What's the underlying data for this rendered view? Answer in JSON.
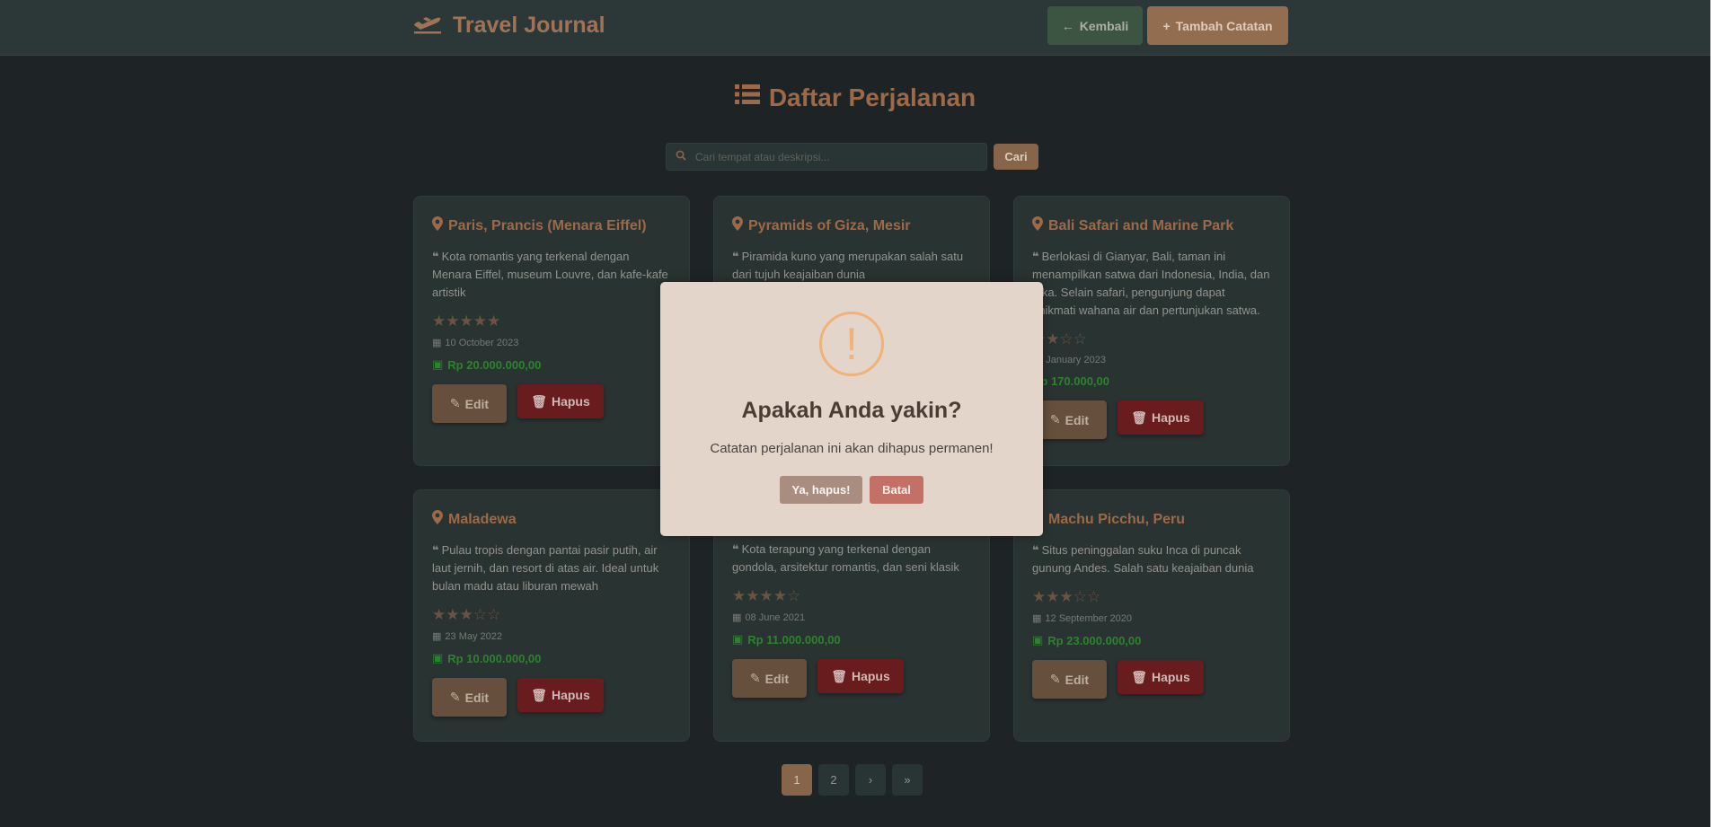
{
  "navbar": {
    "brand": "Travel Journal",
    "back_label": "Kembali",
    "add_label": "Tambah Catatan"
  },
  "page": {
    "title": "Daftar Perjalanan"
  },
  "search": {
    "placeholder": "Cari tempat atau deskripsi...",
    "button_label": "Cari"
  },
  "cards": [
    {
      "title": "Paris, Prancis (Menara Eiffel)",
      "description": "Kota romantis yang terkenal dengan Menara Eiffel, museum Louvre, dan kafe-kafe artistik",
      "rating": 5,
      "stars": "★★★★★",
      "date": "10 October 2023",
      "price": "Rp 20.000.000,00",
      "edit_label": "Edit",
      "delete_label": "Hapus"
    },
    {
      "title": "Pyramids of Giza, Mesir",
      "description": "Piramida kuno yang merupakan salah satu dari tujuh keajaiban dunia",
      "rating": null,
      "stars": "",
      "date": "",
      "price": "",
      "edit_label": "",
      "delete_label": ""
    },
    {
      "title": "Bali Safari and Marine Park",
      "description": "Berlokasi di Gianyar, Bali, taman ini menampilkan satwa dari Indonesia, India, dan frika. Selain safari, pengunjung dapat enikmati wahana air dan pertunjukan satwa.",
      "rating": 2,
      "stars": "★★☆☆",
      "date": "15 January 2023",
      "price": "Rp 170.000,00",
      "edit_label": "Edit",
      "delete_label": "Hapus"
    },
    {
      "title": "Maladewa",
      "description": "Pulau tropis dengan pantai pasir putih, air laut jernih, dan resort di atas air. Ideal untuk bulan madu atau liburan mewah",
      "rating": 3,
      "stars": "★★★☆☆",
      "date": "23 May 2022",
      "price": "Rp 10.000.000,00",
      "edit_label": "Edit",
      "delete_label": "Hapus"
    },
    {
      "title": "",
      "description": "Kota terapung yang terkenal dengan gondola, arsitektur romantis, dan seni klasik",
      "rating": 4,
      "stars": "★★★★☆",
      "date": "08 June 2021",
      "price": "Rp 11.000.000,00",
      "edit_label": "Edit",
      "delete_label": "Hapus"
    },
    {
      "title": "Machu Picchu, Peru",
      "description": "Situs peninggalan suku Inca di puncak gunung Andes. Salah satu keajaiban dunia",
      "rating": 3,
      "stars": "★★★☆☆",
      "date": "12 September 2020",
      "price": "Rp 23.000.000,00",
      "edit_label": "Edit",
      "delete_label": "Hapus"
    }
  ],
  "pagination": {
    "pages": [
      "1",
      "2"
    ],
    "next": "›",
    "last": "»",
    "current": "1"
  },
  "modal": {
    "icon": "!",
    "title": "Apakah Anda yakin?",
    "text": "Catatan perjalanan ini akan dihapus permanen!",
    "confirm_label": "Ya, hapus!",
    "cancel_label": "Batal"
  },
  "colors": {
    "background": "#1f2526",
    "accent": "#a46e4c",
    "price_green": "#2f8a2f",
    "delete_red": "#6e1d1e",
    "warning": "#f1b27a"
  }
}
